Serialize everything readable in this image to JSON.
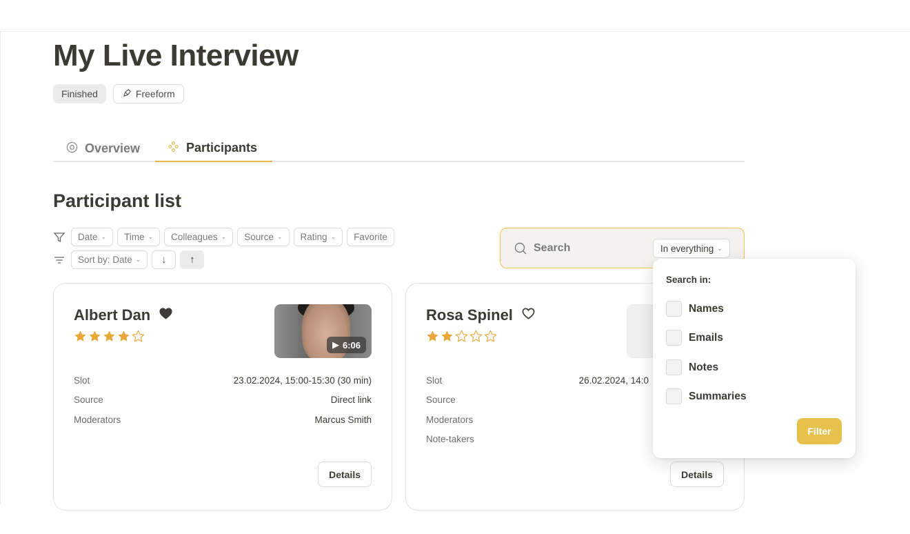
{
  "page": {
    "title": "My Live Interview",
    "badges": {
      "status": "Finished",
      "type": "Freeform"
    }
  },
  "tabs": [
    {
      "label": "Overview",
      "icon": "eye-icon",
      "active": false
    },
    {
      "label": "Participants",
      "icon": "participants-icon",
      "active": true
    }
  ],
  "participant_list": {
    "title": "Participant list",
    "filters": [
      {
        "label": "Date",
        "has_dropdown": true
      },
      {
        "label": "Time",
        "has_dropdown": true
      },
      {
        "label": "Colleagues",
        "has_dropdown": true
      },
      {
        "label": "Source",
        "has_dropdown": true
      },
      {
        "label": "Rating",
        "has_dropdown": true
      },
      {
        "label": "Favorite",
        "has_dropdown": false
      }
    ],
    "sort": {
      "label": "Sort by: Date",
      "descending_icon": "↓",
      "ascending_icon": "↑",
      "active_direction": "ascending"
    }
  },
  "search": {
    "placeholder": "Search",
    "scope": "In everything",
    "dropdown": {
      "title": "Search in:",
      "options": [
        {
          "label": "Names",
          "checked": false
        },
        {
          "label": "Emails",
          "checked": false
        },
        {
          "label": "Notes",
          "checked": false
        },
        {
          "label": "Summaries",
          "checked": false
        }
      ],
      "filter_button": "Filter"
    }
  },
  "participants": [
    {
      "name": "Albert Dan",
      "favorite": true,
      "rating": 4,
      "rating_max": 5,
      "video_duration": "6:06",
      "fields": [
        {
          "label": "Slot",
          "value": "23.02.2024, 15:00-15:30 (30 min)"
        },
        {
          "label": "Source",
          "value": "Direct link"
        },
        {
          "label": "Moderators",
          "value": "Marcus Smith"
        }
      ],
      "details_label": "Details"
    },
    {
      "name": "Rosa Spinel",
      "favorite": false,
      "rating": 2,
      "rating_max": 5,
      "fields": [
        {
          "label": "Slot",
          "value": "26.02.2024, 14:0"
        },
        {
          "label": "Source",
          "value": ""
        },
        {
          "label": "Moderators",
          "value": ""
        },
        {
          "label": "Note-takers",
          "value": ""
        }
      ],
      "details_label": "Details"
    }
  ],
  "colors": {
    "accent": "#e8b94a",
    "filter_button": "#e8c14c",
    "star": "#e9a83a",
    "search_border": "#f0c34b"
  }
}
